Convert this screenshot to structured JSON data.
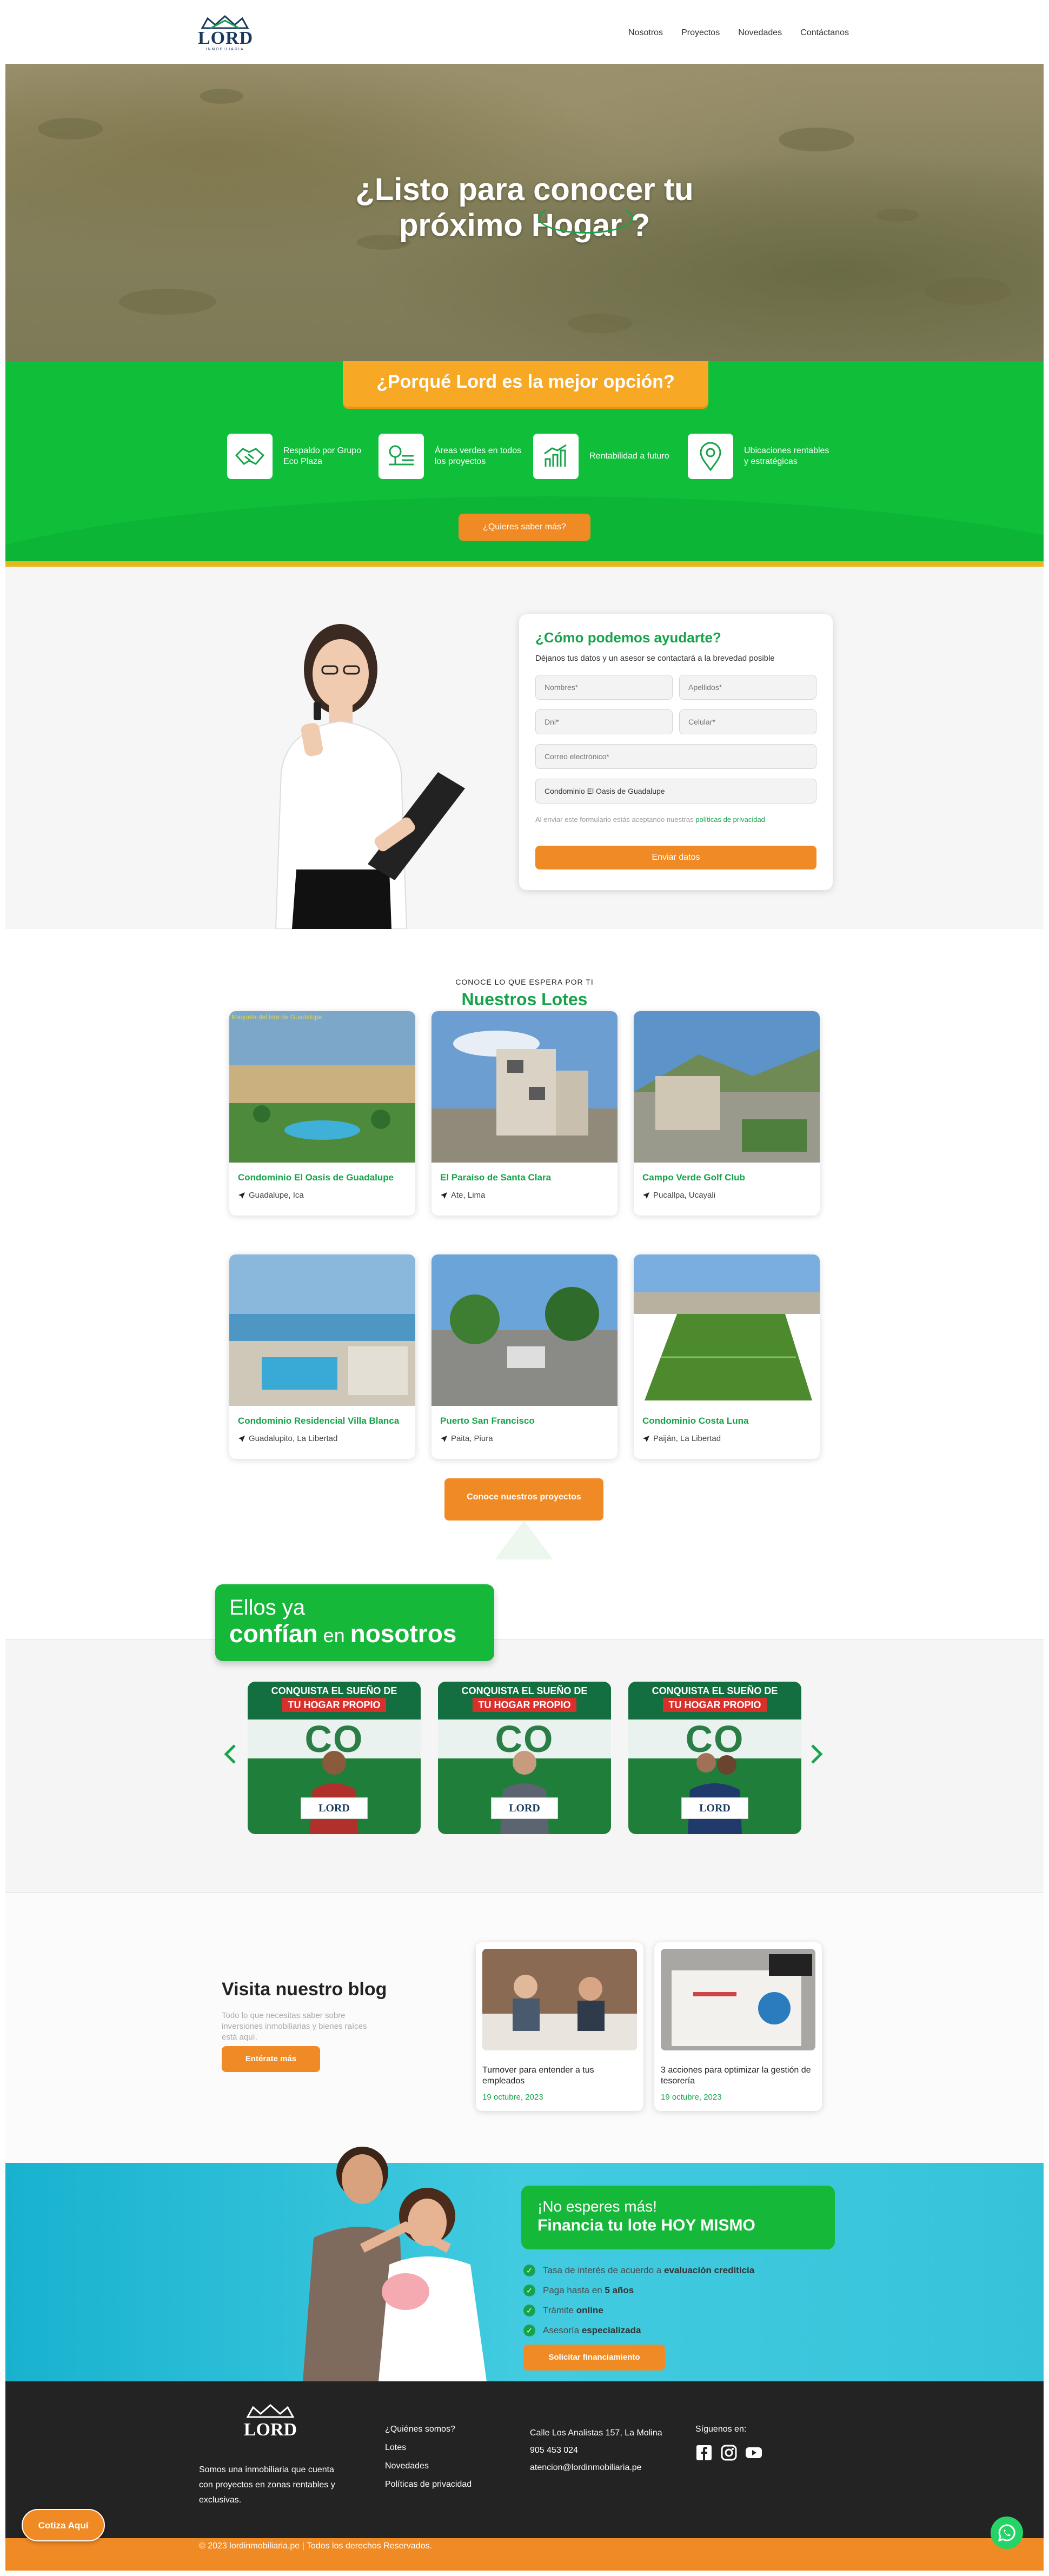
{
  "header": {
    "logo_text": "LORD",
    "logo_sub": "INMOBILIARIA",
    "nav": [
      "Nosotros",
      "Proyectos",
      "Novedades",
      "Contáctanos"
    ]
  },
  "hero": {
    "line1": "¿Listo para conocer tu",
    "line2_a": "próximo ",
    "line2_b": "Hogar",
    "line2_c": " ?"
  },
  "why": {
    "title": "¿Porqué Lord es la mejor opción?",
    "features": [
      {
        "icon": "handshake-icon",
        "text": "Respaldo por Grupo Eco Plaza"
      },
      {
        "icon": "tree-lot-icon",
        "text": "Áreas verdes en todos los proyectos"
      },
      {
        "icon": "growth-chart-icon",
        "text": "Rentabilidad a futuro"
      },
      {
        "icon": "map-pin-icon",
        "text": "Ubicaciones rentables y estratégicas"
      }
    ],
    "button": "¿Quieres saber más?"
  },
  "contact": {
    "title": "¿Cómo podemos ayudarte?",
    "lead": "Déjanos tus datos y un asesor se contactará a la brevedad posible",
    "placeholders": {
      "nombres": "Nombres*",
      "apellidos": "Apellidos*",
      "dni": "Dni*",
      "celular": "Celular*",
      "correo": "Correo electrónico*"
    },
    "project_selected": "Condominio El Oasis de Guadalupe",
    "legal_text": "Al enviar este formulario estás aceptando nuestras ",
    "legal_link": "políticas de privacidad",
    "submit": "Enviar datos"
  },
  "lots": {
    "pretitle": "CONOCE LO QUE ESPERA POR TI",
    "title": "Nuestros Lotes",
    "items": [
      {
        "name": "Condominio El Oasis de Guadalupe",
        "location": "Guadalupe, Ica",
        "overlay": "Maqueta del lote de Guadalupe"
      },
      {
        "name": "El Paraíso de Santa Clara",
        "location": "Ate, Lima"
      },
      {
        "name": "Campo Verde Golf Club",
        "location": "Pucallpa, Ucayali"
      },
      {
        "name": "Condominio Residencial Villa Blanca",
        "location": "Guadalupito, La Libertad"
      },
      {
        "name": "Puerto San Francisco",
        "location": "Paita, Piura"
      },
      {
        "name": "Condominio Costa Luna",
        "location": "Paiján, La Libertad"
      }
    ],
    "button": "Conoce nuestros proyectos"
  },
  "trust": {
    "line1": "Ellos ya",
    "line2_a": "confían",
    "line2_b": " en ",
    "line2_c": "nosotros",
    "card_top1": "CONQUISTA EL SUEÑO DE",
    "card_top2": "TU HOGAR PROPIO",
    "card_banner": "CO PLAZA",
    "card_sign": "LORD"
  },
  "blog": {
    "title": "Visita nuestro blog",
    "text": "Todo lo que necesitas saber sobre inversiones inmobiliarias y bienes raíces está aquí.",
    "button": "Entérate más",
    "posts": [
      {
        "title": "Turnover para entender a tus empleados",
        "date": "19 octubre, 2023"
      },
      {
        "title": "3 acciones para optimizar la gestión de tesorería",
        "date": "19 octubre, 2023"
      }
    ]
  },
  "finance": {
    "line1": "¡No esperes más!",
    "line2": "Financia tu lote HOY MISMO",
    "items": [
      {
        "pre": "Tasa de interés de acuerdo a ",
        "bold": "evaluación crediticia"
      },
      {
        "pre": "Paga hasta en ",
        "bold": "5 años"
      },
      {
        "pre": "Trámite ",
        "bold": "online"
      },
      {
        "pre": "Asesoría ",
        "bold": "especializada"
      }
    ],
    "button": "Solicitar financiamiento"
  },
  "footer": {
    "about": "Somos una inmobiliaria que cuenta con proyectos en zonas rentables y exclusivas.",
    "links": [
      "¿Quiénes somos?",
      "Lotes",
      "Novedades",
      "Políticas de privacidad"
    ],
    "address": "Calle Los Analistas 157, La Molina",
    "phone": "905 453 024",
    "email": "atencion@lordinmobiliaria.pe",
    "social_title": "Síguenos en:",
    "copyright": "© 2023 lordinmobiliaria.pe | Todos los derechos Reservados.",
    "cotiza": "Cotiza Aquí"
  },
  "colors": {
    "green": "#16a34a",
    "orange": "#f08a24",
    "yellow": "#f7a824",
    "footer": "#232323"
  }
}
